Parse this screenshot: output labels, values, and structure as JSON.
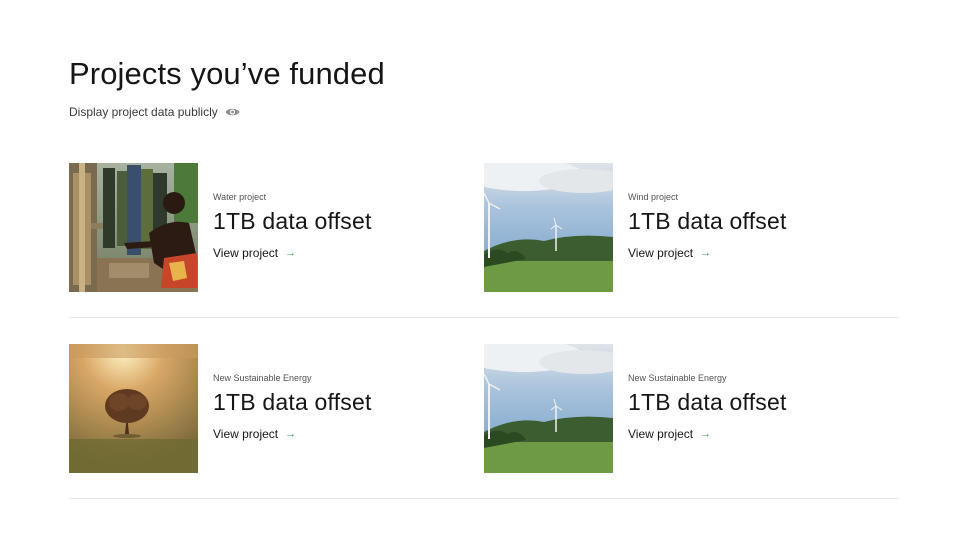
{
  "header": {
    "title": "Projects you’ve funded",
    "toggle_label": "Display project data publicly",
    "toggle_icon": "eye-icon"
  },
  "colors": {
    "accent_arrow": "#24a148",
    "divider": "#e8e8e8"
  },
  "projects": [
    {
      "category": "Water project",
      "headline": "1TB data offset",
      "link_label": "View project",
      "link_icon": "arrow-right-icon",
      "image": "water-pump-photo"
    },
    {
      "category": "Wind project",
      "headline": "1TB data offset",
      "link_label": "View project",
      "link_icon": "arrow-right-icon",
      "image": "wind-turbines-photo"
    },
    {
      "category": "New Sustainable Energy",
      "headline": "1TB data offset",
      "link_label": "View project",
      "link_icon": "arrow-right-icon",
      "image": "misty-tree-photo"
    },
    {
      "category": "New Sustainable Energy",
      "headline": "1TB data offset",
      "link_label": "View project",
      "link_icon": "arrow-right-icon",
      "image": "wind-turbines-photo"
    }
  ],
  "arrow_glyph": "→"
}
